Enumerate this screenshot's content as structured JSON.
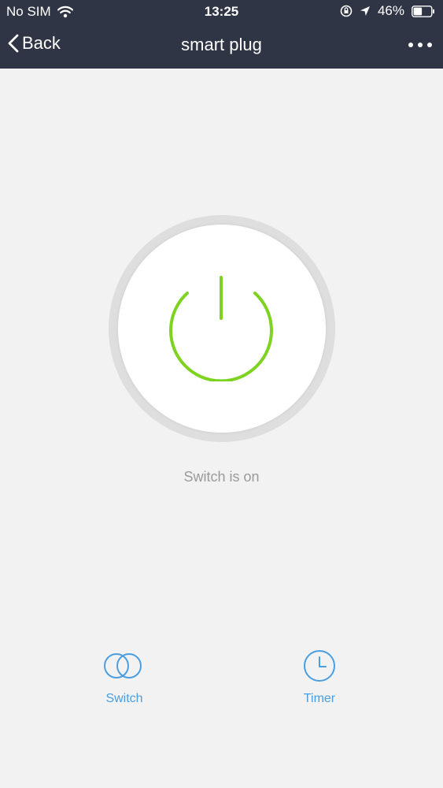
{
  "status_bar": {
    "carrier": "No SIM",
    "time": "13:25",
    "battery": "46%",
    "battery_level": 0.46,
    "icons": [
      "wifi-icon",
      "orientation-lock-icon",
      "location-arrow-icon",
      "battery-icon"
    ]
  },
  "nav": {
    "back_label": "Back",
    "title": "smart plug",
    "more_icon": "more-dots-icon"
  },
  "power": {
    "state": "on",
    "status_text": "Switch is on",
    "icon": "power-icon"
  },
  "tabs": [
    {
      "label": "Switch",
      "icon": "switch-toggle-icon"
    },
    {
      "label": "Timer",
      "icon": "clock-icon"
    }
  ],
  "colors": {
    "nav_bg": "#2f3545",
    "page_bg": "#f2f2f2",
    "power_green": "#7ed321",
    "ring_grey": "#dedede",
    "tab_blue": "#4a9ee0",
    "status_text": "#9a9a9a"
  }
}
